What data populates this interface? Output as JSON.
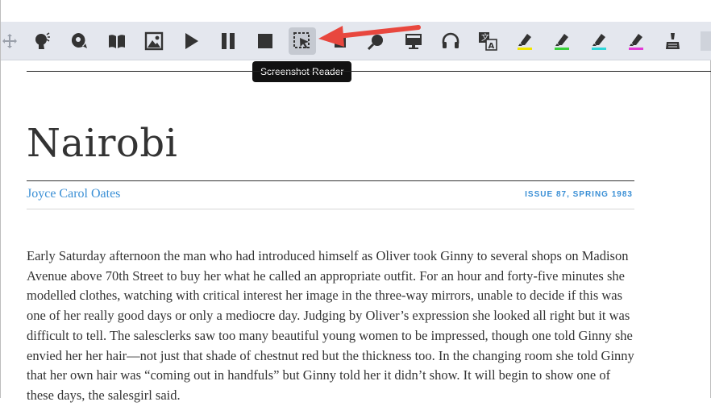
{
  "toolbar": {
    "tooltip": "Screenshot Reader",
    "buttons": [
      {
        "name": "move-handle-icon"
      },
      {
        "name": "talk-and-type-icon"
      },
      {
        "name": "voice-search-icon"
      },
      {
        "name": "dictionary-icon"
      },
      {
        "name": "picture-dictionary-icon"
      },
      {
        "name": "play-icon"
      },
      {
        "name": "pause-icon"
      },
      {
        "name": "stop-icon"
      },
      {
        "name": "screenshot-reader-icon"
      },
      {
        "name": "audio-maker-icon"
      },
      {
        "name": "screen-mask-icon"
      },
      {
        "name": "headphones-icon"
      },
      {
        "name": "translate-icon"
      },
      {
        "name": "highlight-yellow-icon",
        "color": "#f2e600"
      },
      {
        "name": "highlight-green-icon",
        "color": "#39d13a"
      },
      {
        "name": "highlight-cyan-icon",
        "color": "#2fd6d9"
      },
      {
        "name": "highlight-pink-icon",
        "color": "#e23ad6"
      },
      {
        "name": "clear-highlights-icon"
      }
    ]
  },
  "article": {
    "title": "Nairobi",
    "author": "Joyce Carol Oates",
    "issue": "ISSUE 87, SPRING 1983",
    "body": "Early Saturday afternoon the man who had introduced himself as Oliver took Ginny to several shops on Madison Avenue above 70th Street to buy her what he called an appropriate outfit. For an hour and forty-five minutes she modelled clothes, watching with critical interest her image in the three-way mirrors, unable to decide if this was one of her really good days or only a mediocre day. Judging by Oliver’s expression she looked all right but it was difficult to tell. The salesclerks saw too many beautiful young women to be impressed, though one told Ginny she envied her her hair—not just that shade of chestnut red but the thickness too. In the changing room she told Ginny that her own hair was “coming out in handfuls” but Ginny told her it didn’t show. It will begin to show one of these days, the salesgirl said."
  },
  "colors": {
    "link": "#3a8fd5",
    "toolbar_bg": "#e4e7ee",
    "arrow": "#e8473e"
  }
}
